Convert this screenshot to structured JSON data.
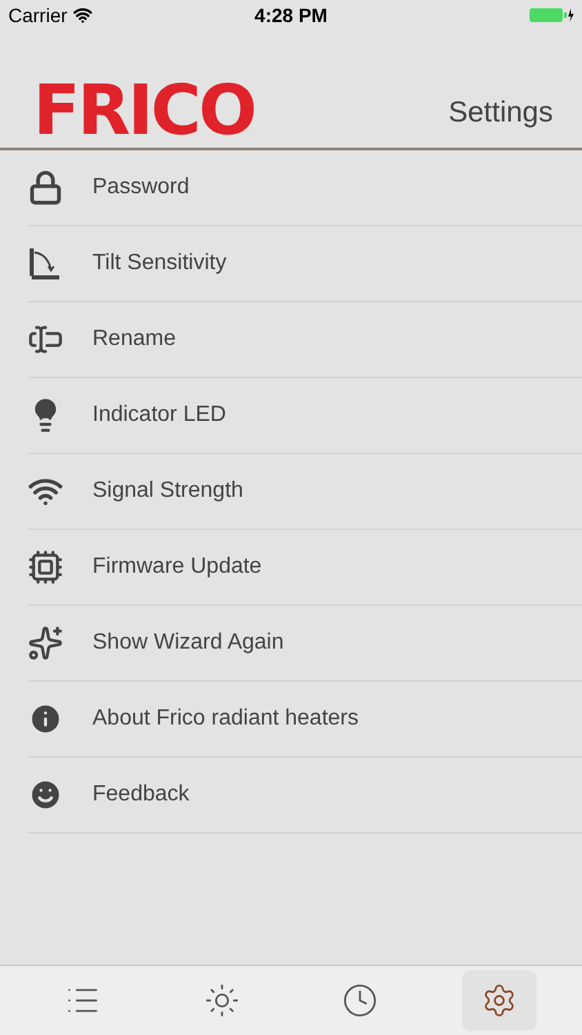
{
  "status_bar": {
    "carrier": "Carrier",
    "time": "4:28 PM"
  },
  "header": {
    "logo": "FRICO",
    "title": "Settings"
  },
  "settings_items": [
    {
      "kind": "lock",
      "label": "Password"
    },
    {
      "kind": "tilt",
      "label": "Tilt Sensitivity"
    },
    {
      "kind": "rename",
      "label": "Rename"
    },
    {
      "kind": "bulb",
      "label": "Indicator LED"
    },
    {
      "kind": "signal",
      "label": "Signal Strength"
    },
    {
      "kind": "chip",
      "label": "Firmware Update"
    },
    {
      "kind": "wizard",
      "label": "Show Wizard Again"
    },
    {
      "kind": "info",
      "label": "About Frico radiant heaters"
    },
    {
      "kind": "smile",
      "label": "Feedback"
    }
  ],
  "tab_bar": [
    {
      "kind": "list",
      "selected": false
    },
    {
      "kind": "sun",
      "selected": false
    },
    {
      "kind": "clock",
      "selected": false
    },
    {
      "kind": "settings",
      "selected": true
    }
  ]
}
